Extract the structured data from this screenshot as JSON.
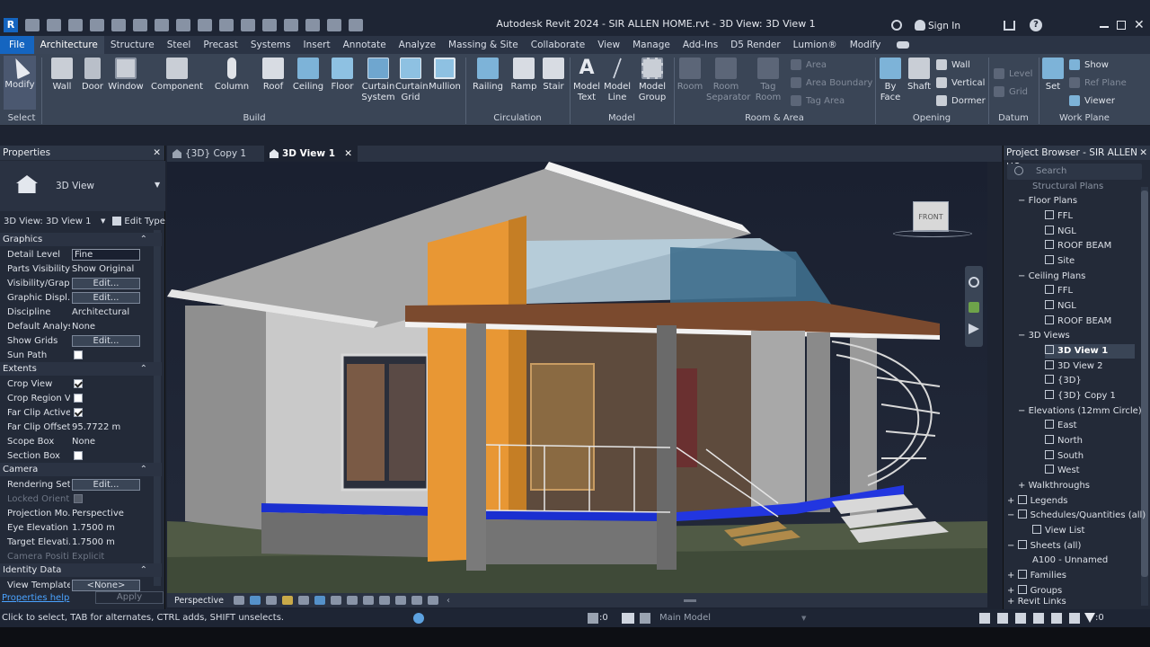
{
  "titlebar": {
    "title": "Autodesk Revit 2024 - SIR ALLEN HOME.rvt - 3D View: 3D View 1",
    "sign_in": "Sign In"
  },
  "menu": [
    "File",
    "Architecture",
    "Structure",
    "Steel",
    "Precast",
    "Systems",
    "Insert",
    "Annotate",
    "Analyze",
    "Massing & Site",
    "Collaborate",
    "View",
    "Manage",
    "Add-Ins",
    "D5 Render",
    "Lumion®",
    "Modify"
  ],
  "ribbon": {
    "modify": "Modify",
    "select": "Select",
    "build": [
      "Wall",
      "Door",
      "Window",
      "Component",
      "Column",
      "Roof",
      "Ceiling",
      "Floor",
      "Curtain System",
      "Curtain Grid",
      "Mullion"
    ],
    "build_label": "Build",
    "circulation": [
      "Railing",
      "Ramp",
      "Stair"
    ],
    "circulation_label": "Circulation",
    "model": [
      "Model Text",
      "Model Line",
      "Model Group"
    ],
    "model_label": "Model",
    "room": [
      "Room",
      "Room Separator",
      "Tag Room",
      "Area",
      "Area Boundary",
      "Tag Area"
    ],
    "room_label": "Room & Area",
    "opening": [
      "By Face",
      "Shaft",
      "Wall",
      "Vertical",
      "Dormer"
    ],
    "opening_label": "Opening",
    "datum": [
      "Level",
      "Grid"
    ],
    "datum_label": "Datum",
    "workplane": [
      "Set",
      "Show",
      "Ref Plane",
      "Viewer"
    ],
    "workplane_label": "Work Plane"
  },
  "properties": {
    "title": "Properties",
    "type_name": "3D View",
    "instance": "3D View: 3D View 1",
    "edit_type": "Edit Type",
    "cat_graphics": "Graphics",
    "cat_extents": "Extents",
    "cat_camera": "Camera",
    "cat_identity": "Identity Data",
    "rows": [
      {
        "k": "Detail Level",
        "v": "Fine"
      },
      {
        "k": "Parts Visibility",
        "v": "Show Original"
      },
      {
        "k": "Visibility/Grap...",
        "v": "Edit..."
      },
      {
        "k": "Graphic Displ...",
        "v": "Edit..."
      },
      {
        "k": "Discipline",
        "v": "Architectural"
      },
      {
        "k": "Default Analys...",
        "v": "None"
      },
      {
        "k": "Show Grids",
        "v": "Edit..."
      },
      {
        "k": "Sun Path",
        "v": ""
      },
      {
        "k": "Crop View",
        "v": ""
      },
      {
        "k": "Crop Region V...",
        "v": ""
      },
      {
        "k": "Far Clip Active",
        "v": ""
      },
      {
        "k": "Far Clip Offset",
        "v": "95.7722 m"
      },
      {
        "k": "Scope Box",
        "v": "None"
      },
      {
        "k": "Section Box",
        "v": ""
      },
      {
        "k": "Rendering Set...",
        "v": "Edit..."
      },
      {
        "k": "Locked Orient...",
        "v": ""
      },
      {
        "k": "Projection Mo...",
        "v": "Perspective"
      },
      {
        "k": "Eye Elevation",
        "v": "1.7500 m"
      },
      {
        "k": "Target Elevati...",
        "v": "1.7500 m"
      },
      {
        "k": "Camera Positi...",
        "v": "Explicit"
      },
      {
        "k": "View Template",
        "v": "<None>"
      }
    ],
    "help": "Properties help",
    "apply": "Apply"
  },
  "tabs": [
    "{3D} Copy 1",
    "3D View 1"
  ],
  "viewcube": "FRONT",
  "view_control": "Perspective",
  "browser": {
    "title": "Project Browser - SIR ALLEN HO...",
    "search": "Search",
    "items": [
      "Structural Plans",
      "Floor Plans",
      "FFL",
      "NGL",
      "ROOF BEAM",
      "Site",
      "Ceiling Plans",
      "FFL",
      "NGL",
      "ROOF BEAM",
      "3D Views",
      "3D View 1",
      "3D View 2",
      "{3D}",
      "{3D} Copy 1",
      "Elevations (12mm Circle)",
      "East",
      "North",
      "South",
      "West",
      "Walkthroughs",
      "Legends",
      "Schedules/Quantities (all)",
      "View List",
      "Sheets (all)",
      "A100 - Unnamed",
      "Families",
      "Groups",
      "Revit Links"
    ]
  },
  "status": {
    "hint": "Click to select, TAB for alternates, CTRL adds, SHIFT unselects.",
    "zero1": ":0",
    "model": "Main Model",
    "zero2": ":0"
  },
  "colors": {
    "accent": "#1565c0",
    "panel": "#232a38",
    "ribbon": "#3a4556"
  }
}
